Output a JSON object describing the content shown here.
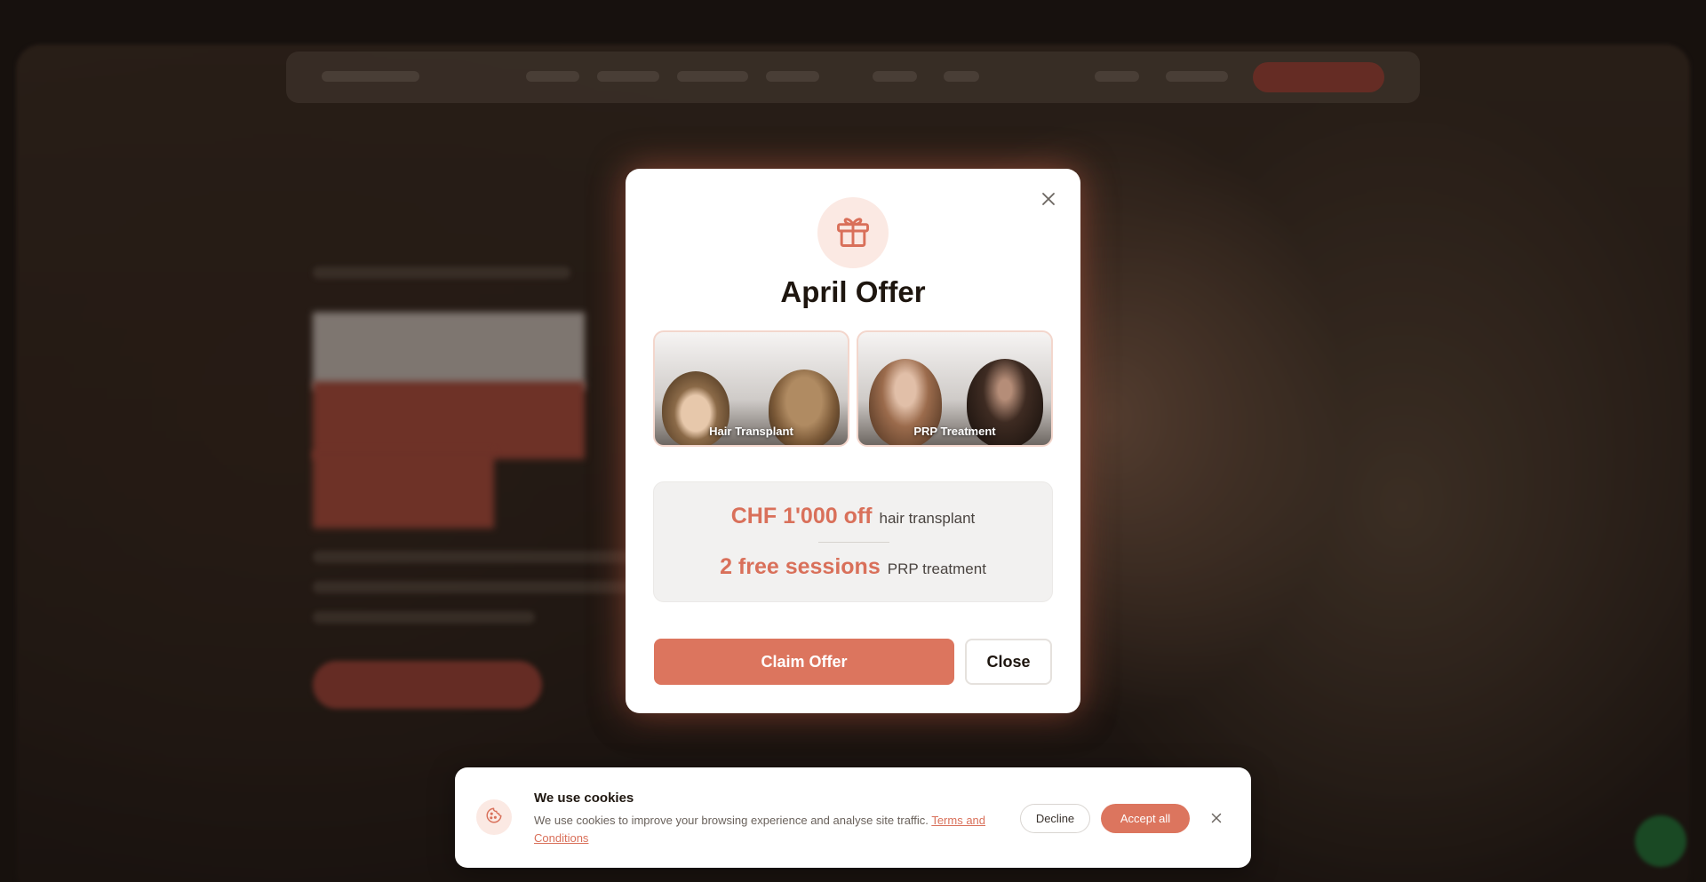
{
  "modal": {
    "title": "April Offer",
    "cards": [
      {
        "label": "Hair Transplant"
      },
      {
        "label": "PRP Treatment"
      }
    ],
    "offers": [
      {
        "highlight": "CHF 1'000 off",
        "detail": "hair transplant"
      },
      {
        "highlight": "2 free sessions",
        "detail": "PRP treatment"
      }
    ],
    "claim_label": "Claim Offer",
    "close_label": "Close",
    "icons": {
      "header": "gift-icon",
      "dismiss": "close-icon"
    }
  },
  "cookie_banner": {
    "title": "We use cookies",
    "text": "We use cookies to improve your browsing experience and analyse site traffic.",
    "link_text": "Terms and Conditions",
    "decline_label": "Decline",
    "accept_label": "Accept all",
    "icons": {
      "badge": "cookie-icon",
      "dismiss": "close-icon"
    }
  },
  "colors": {
    "accent": "#dc755e",
    "accent_soft": "#fbe9e3",
    "text_dark": "#1e160f"
  }
}
